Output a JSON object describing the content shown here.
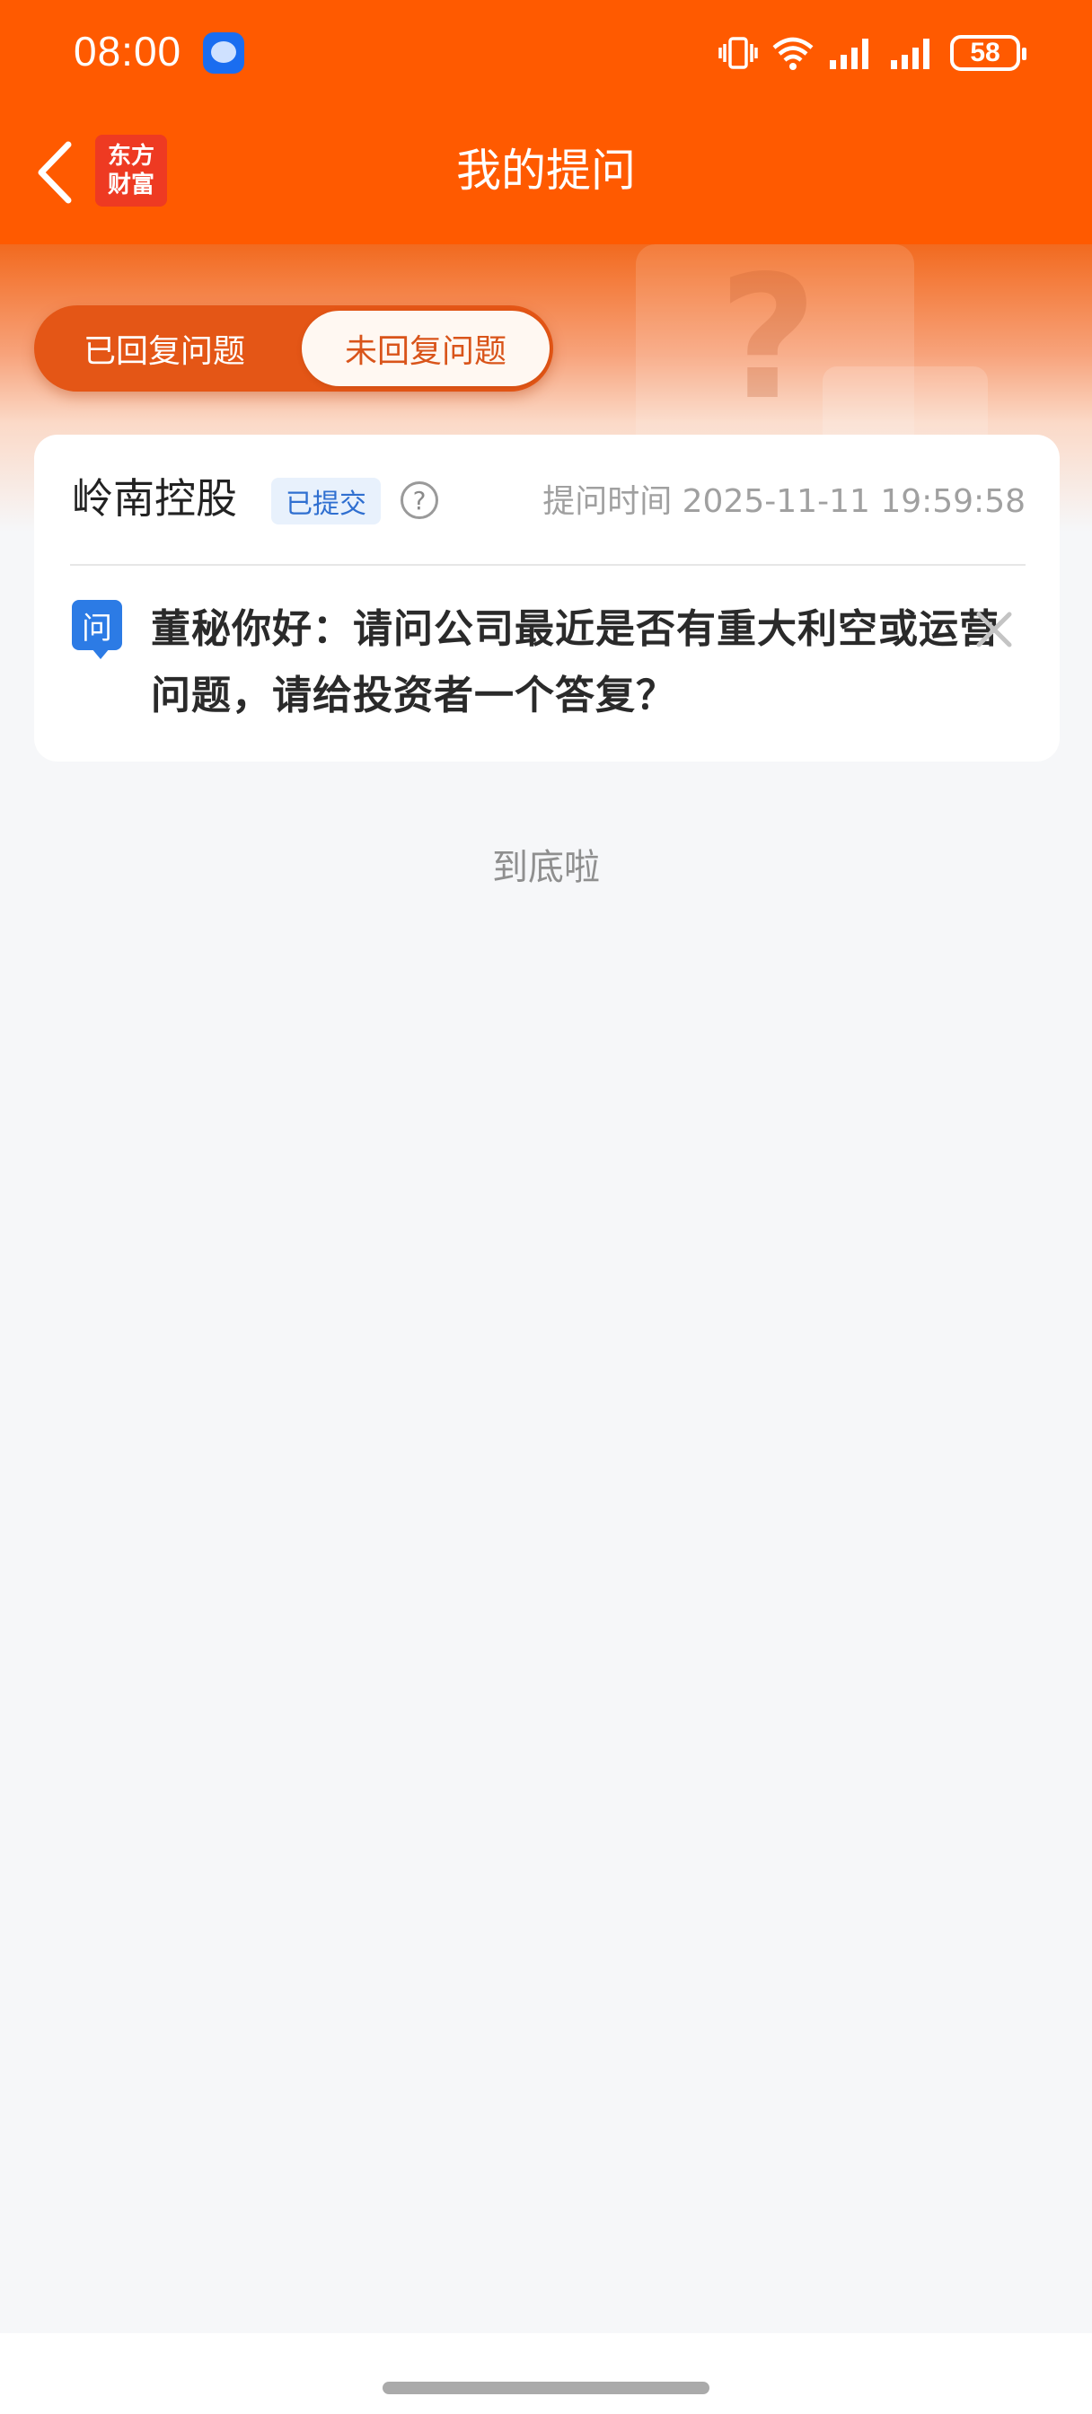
{
  "status_bar": {
    "time": "08:00",
    "battery": "58"
  },
  "header": {
    "title": "我的提问",
    "logo_line1": "东方",
    "logo_line2": "财富"
  },
  "tabs": {
    "replied": "已回复问题",
    "unreplied": "未回复问题",
    "active": "unreplied"
  },
  "question_card": {
    "company": "岭南控股",
    "status_badge": "已提交",
    "time_label": "提问时间",
    "time_value": "2025-11-11 19:59:58",
    "q_icon_text": "问",
    "question": "董秘你好：请问公司最近是否有重大利空或运营问题，请给投资者一个答复？"
  },
  "footer": {
    "end_text": "到底啦"
  },
  "colors": {
    "brand": "#ff5a00",
    "badge_text": "#2f6fd0",
    "q_icon": "#2c7be5"
  }
}
